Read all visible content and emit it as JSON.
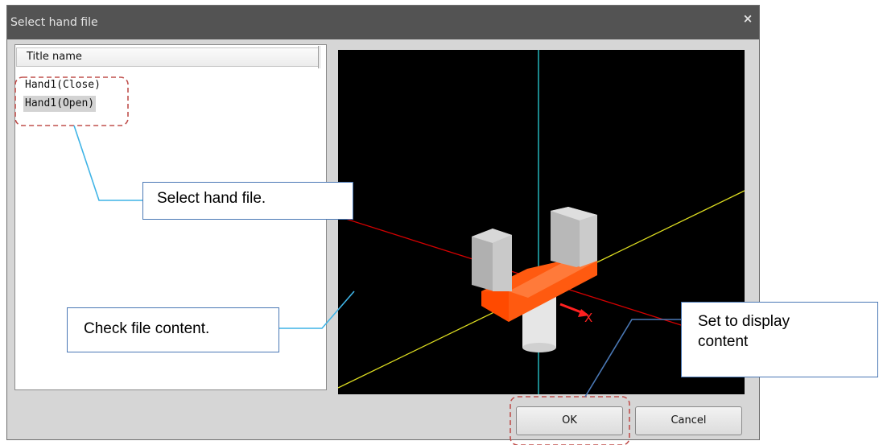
{
  "window": {
    "title": "Select hand file",
    "close_glyph": "×"
  },
  "list": {
    "header": "Title name",
    "items": [
      {
        "label": "Hand1(Close)",
        "selected": false
      },
      {
        "label": "Hand1(Open)",
        "selected": true
      }
    ]
  },
  "preview": {
    "axis_label": "X",
    "colors": {
      "background": "#000000",
      "z_axis": "#2ad0d8",
      "x_axis": "#d40000",
      "y_axis": "#dcdc20",
      "hand_body": "#ff5a10",
      "fingers": "#c8c8c8",
      "flange": "#e6e6e6"
    }
  },
  "buttons": {
    "ok": "OK",
    "cancel": "Cancel"
  },
  "annotations": {
    "select_hand": "Select hand file.",
    "check_content": "Check file content.",
    "set_display_line1": "Set to display",
    "set_display_line2": "content",
    "line_color": "#3fb4e6",
    "dash_color": "#c0504d",
    "box_border": "#4a78b5"
  }
}
